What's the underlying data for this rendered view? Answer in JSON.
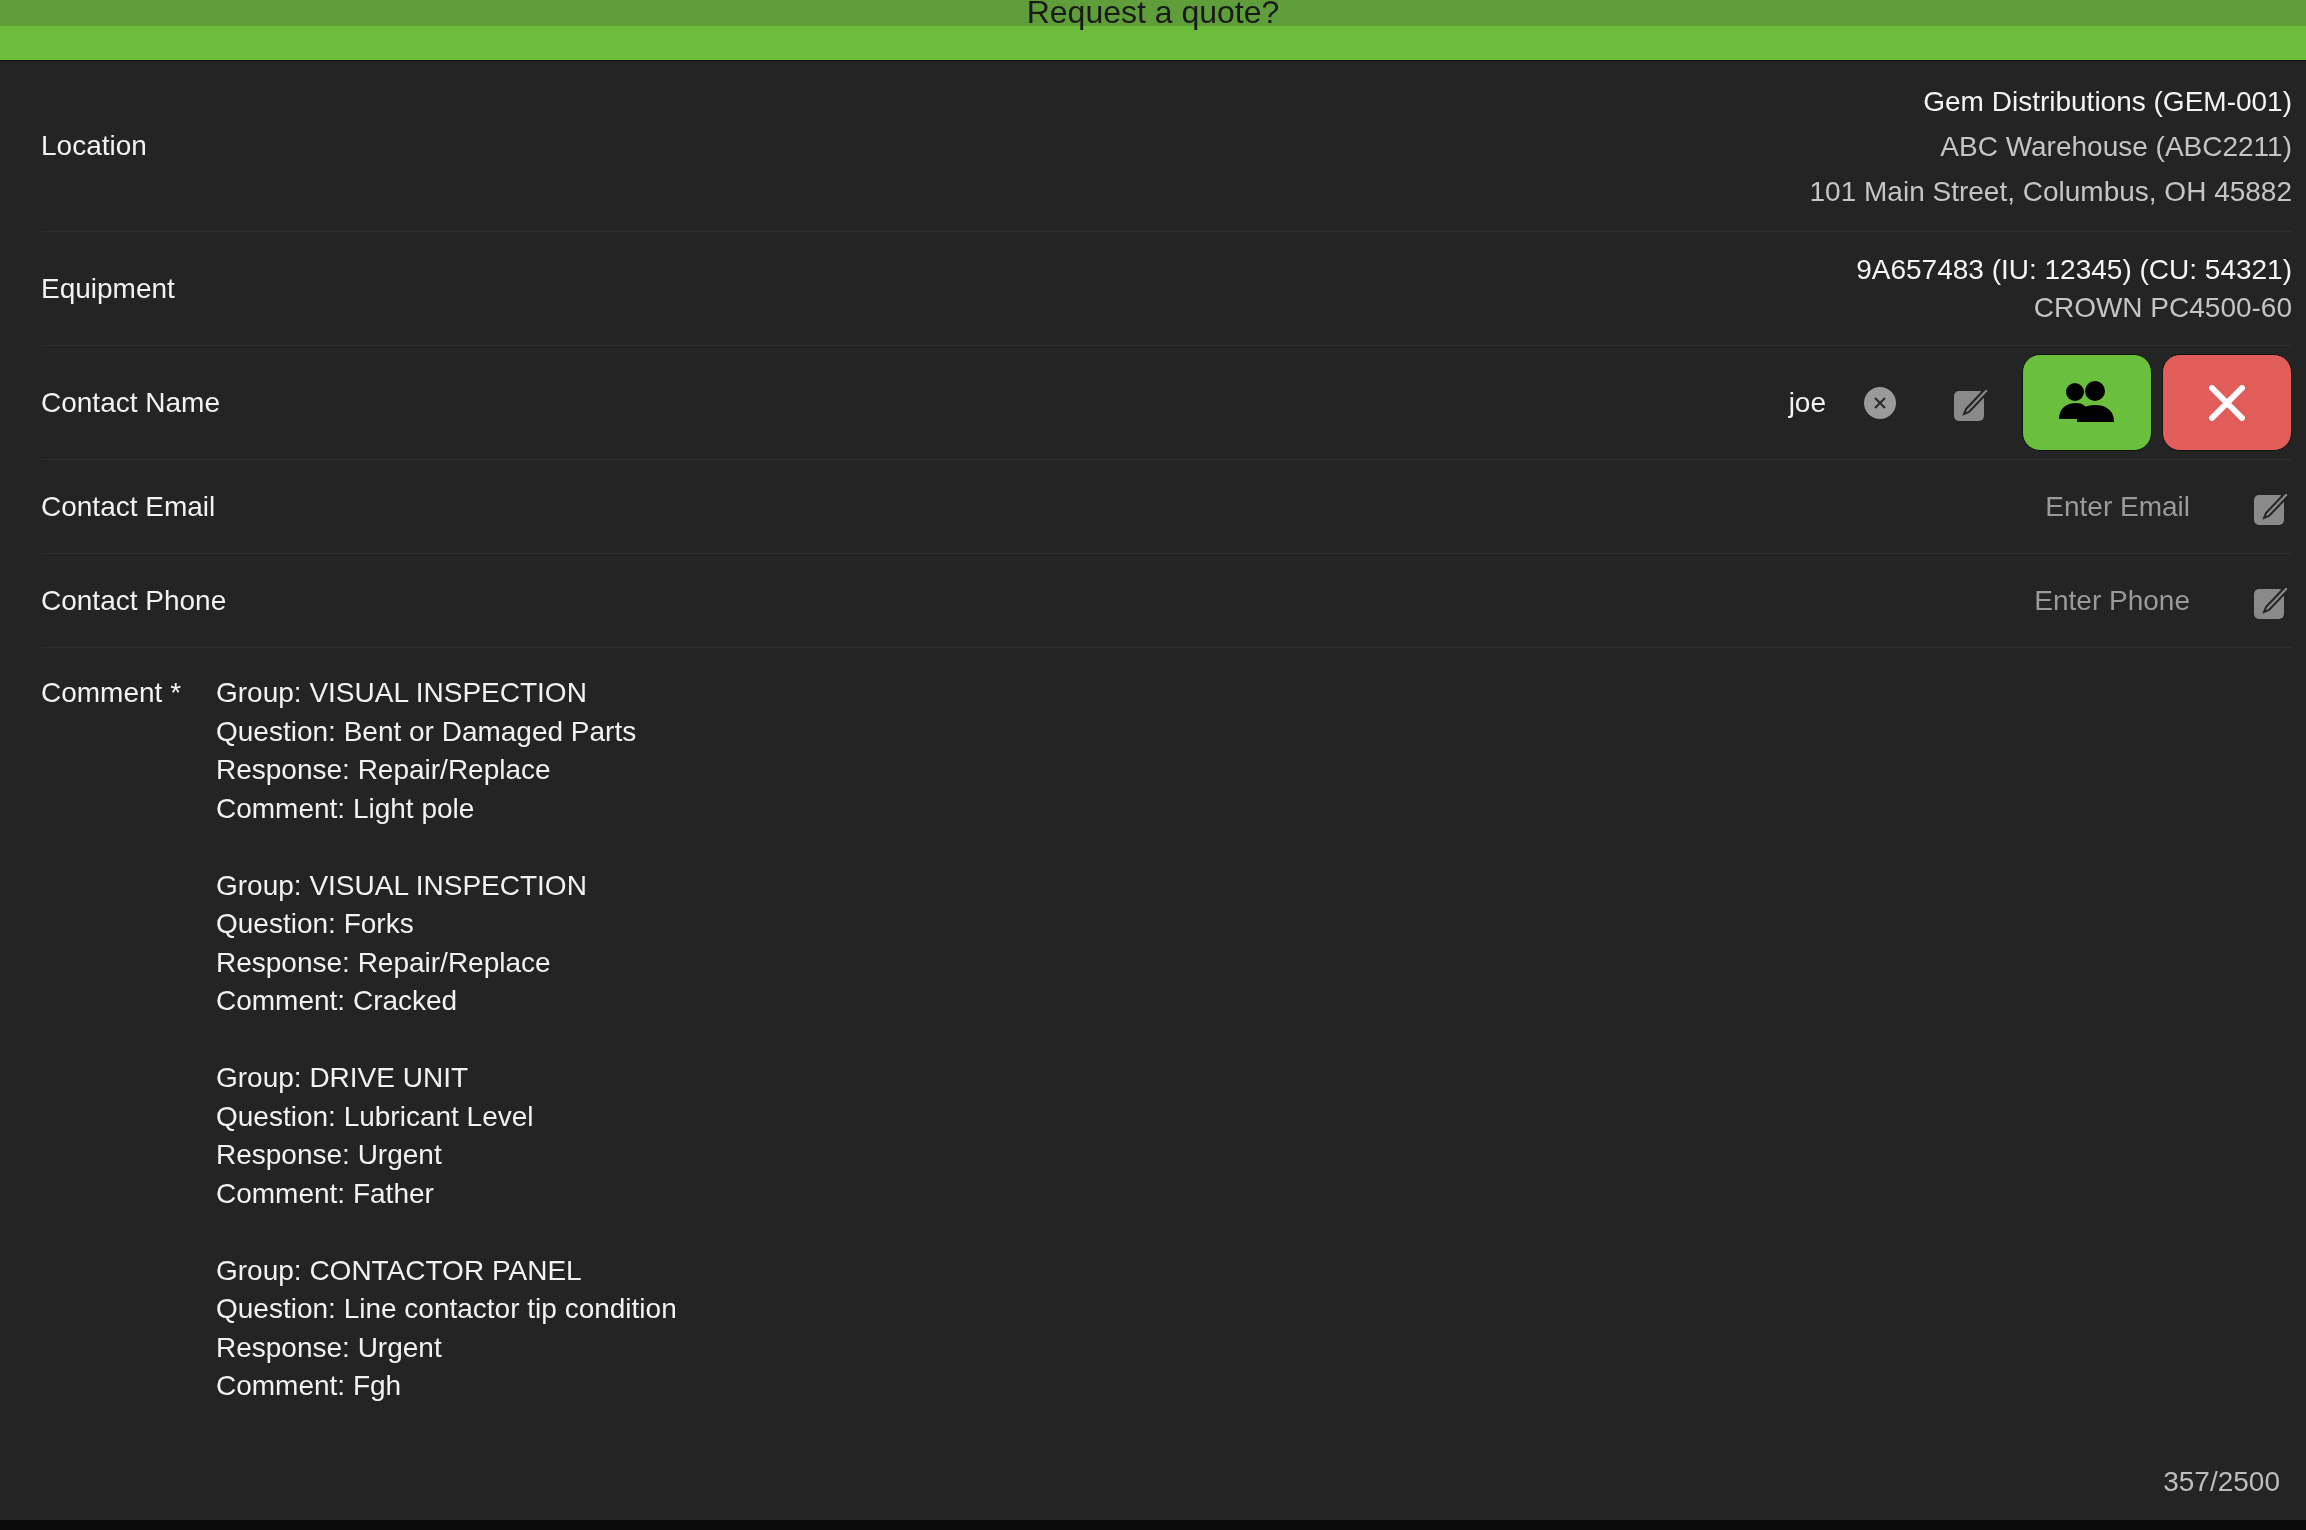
{
  "header": {
    "title": "Request a quote?"
  },
  "location": {
    "label": "Location",
    "lines": [
      "Gem Distributions (GEM-001)",
      "ABC Warehouse (ABC2211)",
      "101 Main Street, Columbus, OH 45882"
    ]
  },
  "equipment": {
    "label": "Equipment",
    "lines": [
      "9A657483 (IU: 12345) (CU: 54321)",
      "CROWN PC4500-60"
    ]
  },
  "contact_name": {
    "label": "Contact Name",
    "value": "joe"
  },
  "contact_email": {
    "label": "Contact Email",
    "placeholder": "Enter Email"
  },
  "contact_phone": {
    "label": "Contact Phone",
    "placeholder": "Enter Phone"
  },
  "comment": {
    "label": "Comment *",
    "value": "Group: VISUAL INSPECTION\nQuestion: Bent or Damaged Parts\nResponse: Repair/Replace\nComment: Light pole\n\nGroup: VISUAL INSPECTION\nQuestion: Forks\nResponse: Repair/Replace\nComment: Cracked\n\nGroup: DRIVE UNIT\nQuestion: Lubricant Level\nResponse: Urgent\nComment: Father\n\nGroup: CONTACTOR PANEL\nQuestion: Line contactor tip condition\nResponse: Urgent\nComment: Fgh",
    "counter": "357/2500"
  }
}
